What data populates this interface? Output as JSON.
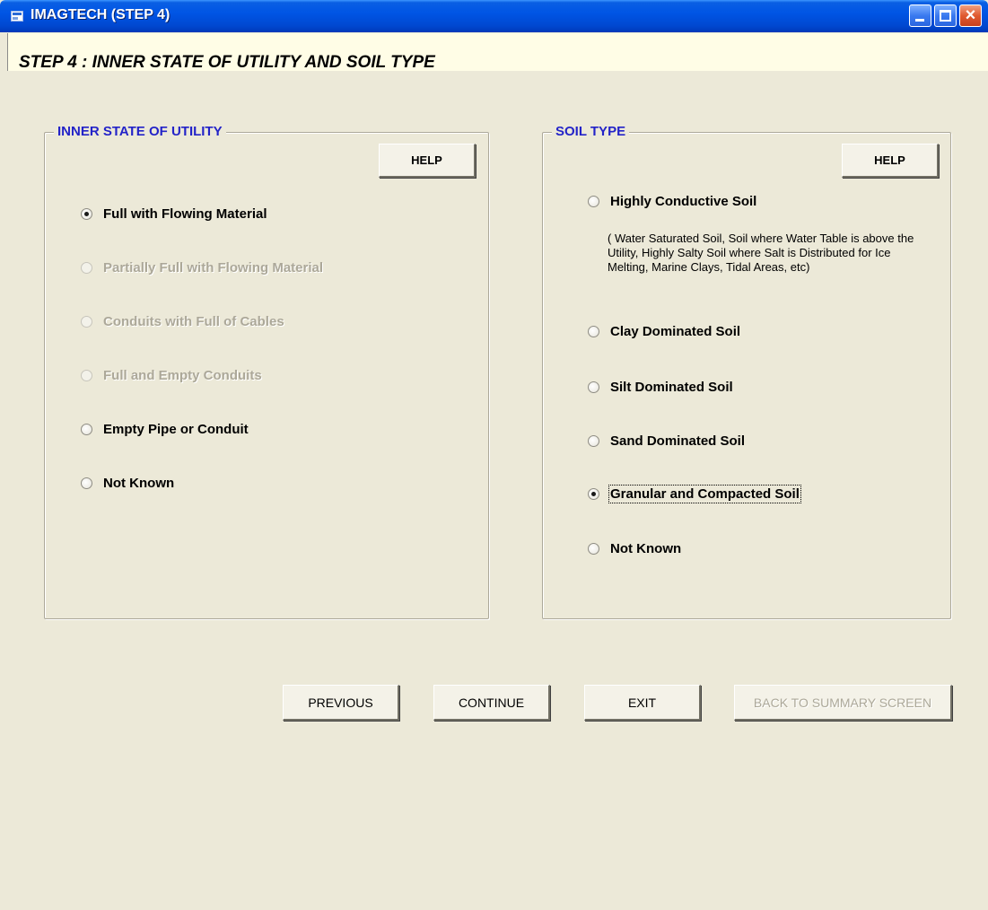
{
  "window": {
    "title": "IMAGTECH (STEP 4)",
    "controls": {
      "minimize": "minimize",
      "maximize": "maximize",
      "close": "×"
    }
  },
  "step_header": "STEP 4 : INNER STATE OF UTILITY AND SOIL TYPE",
  "inner_state": {
    "legend": "INNER STATE OF UTILITY",
    "help_label": "HELP",
    "options": [
      {
        "label": "Full with Flowing Material",
        "checked": true,
        "enabled": true
      },
      {
        "label": "Partially Full with Flowing Material",
        "checked": false,
        "enabled": false
      },
      {
        "label": "Conduits with Full of Cables",
        "checked": false,
        "enabled": false
      },
      {
        "label": "Full and Empty Conduits",
        "checked": false,
        "enabled": false
      },
      {
        "label": "Empty Pipe or Conduit",
        "checked": false,
        "enabled": true
      },
      {
        "label": "Not Known",
        "checked": false,
        "enabled": true
      }
    ]
  },
  "soil_type": {
    "legend": "SOIL TYPE",
    "help_label": "HELP",
    "options": [
      {
        "label": "Highly Conductive Soil",
        "checked": false,
        "enabled": true
      },
      {
        "label": "Clay Dominated Soil",
        "checked": false,
        "enabled": true
      },
      {
        "label": "Silt Dominated Soil",
        "checked": false,
        "enabled": true
      },
      {
        "label": "Sand Dominated Soil",
        "checked": false,
        "enabled": true
      },
      {
        "label": "Granular and Compacted Soil",
        "checked": true,
        "enabled": true
      },
      {
        "label": "Not Known",
        "checked": false,
        "enabled": true
      }
    ],
    "conductive_note": "( Water Saturated Soil, Soil where Water Table is above the Utility, Highly Salty Soil where Salt is Distributed for Ice Melting, Marine Clays, Tidal Areas, etc)"
  },
  "buttons": {
    "previous": "PREVIOUS",
    "continue": "CONTINUE",
    "exit": "EXIT",
    "back_to_summary": "BACK TO SUMMARY SCREEN"
  },
  "colors": {
    "window_bg": "#ece9d8",
    "titlebar": "#0055e5",
    "legend_text": "#2323c8",
    "disabled_text": "#aca899",
    "header_bg": "#fffde6"
  }
}
